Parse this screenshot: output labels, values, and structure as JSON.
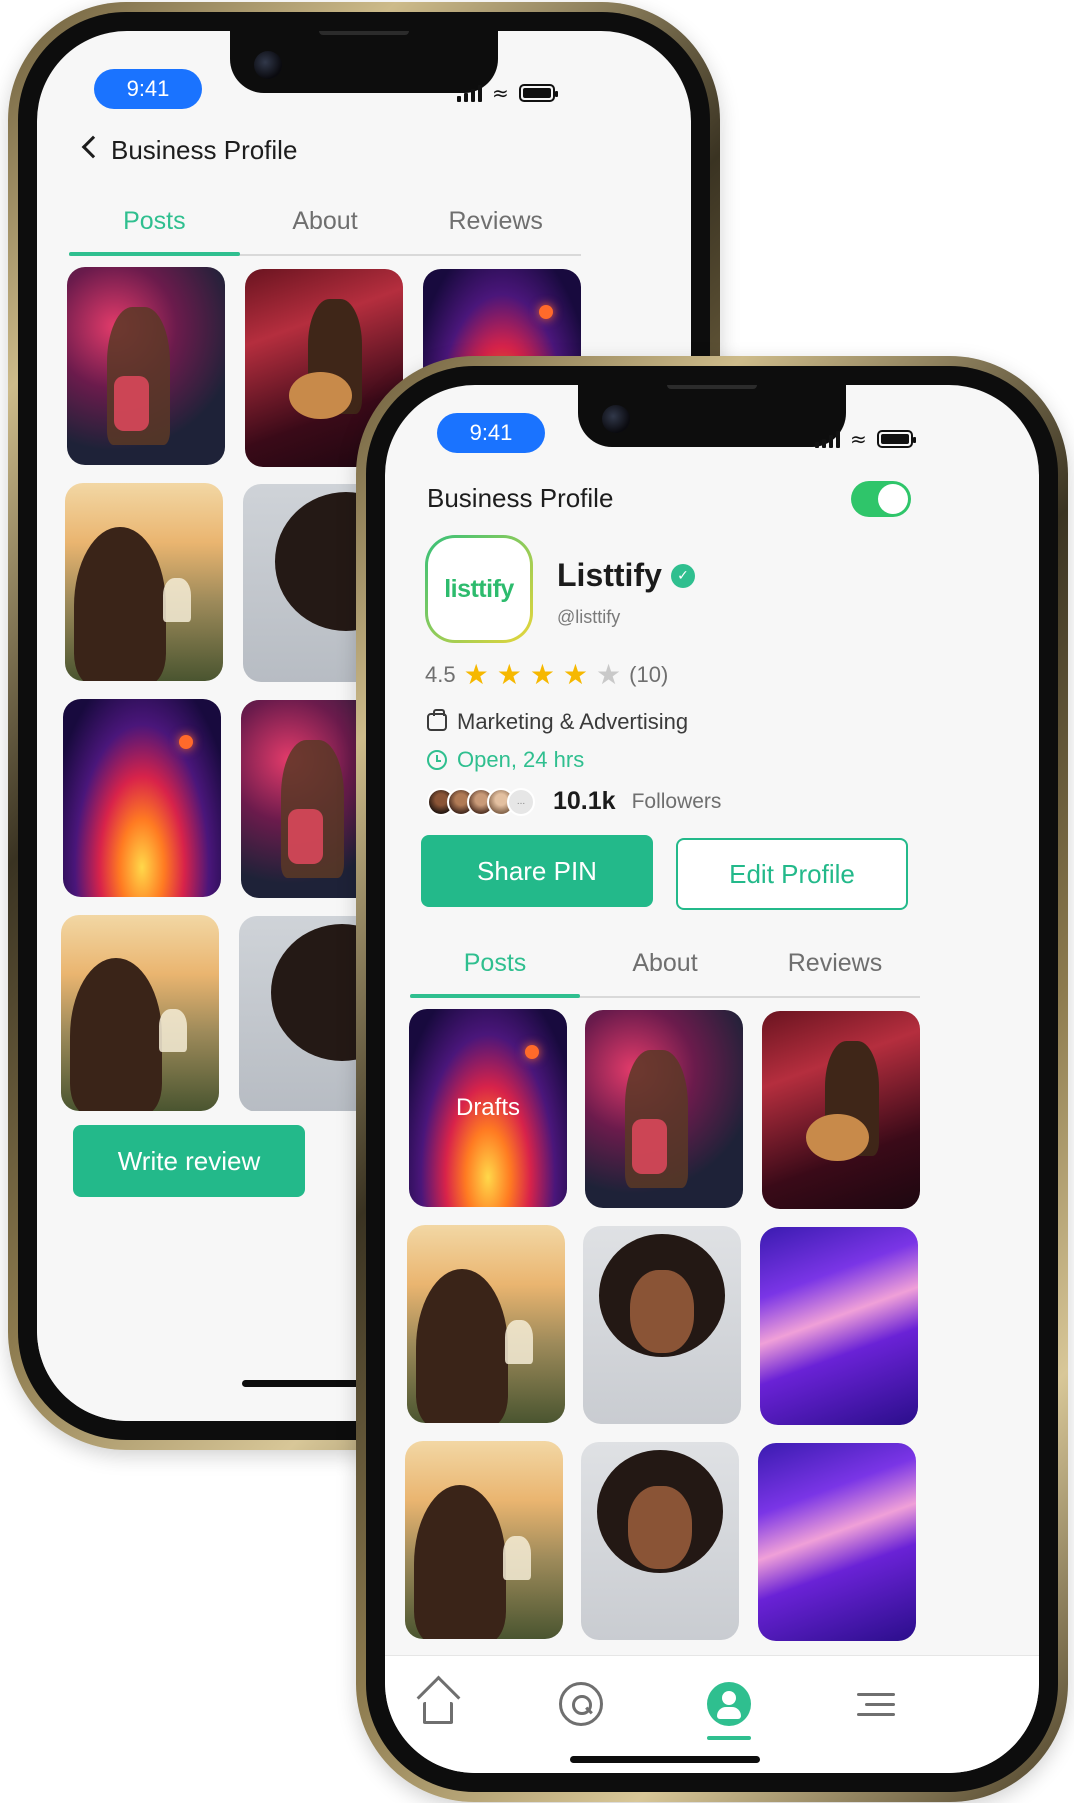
{
  "back_screen": {
    "status_time": "9:41",
    "header_title": "Business Profile",
    "tabs": [
      {
        "label": "Posts",
        "active": true
      },
      {
        "label": "About",
        "active": false
      },
      {
        "label": "Reviews",
        "active": false
      }
    ],
    "write_review_label": "Write review"
  },
  "front_screen": {
    "status_time": "9:41",
    "header_title": "Business Profile",
    "business_active": true,
    "logo_text": "listtify",
    "brand_name": "Listtify",
    "verified": true,
    "handle": "@listtify",
    "rating": {
      "score": "4.5",
      "stars_filled": 4,
      "stars_total": 5,
      "count": "(10)"
    },
    "category": "Marketing & Advertising",
    "hours": "Open, 24 hrs",
    "followers": {
      "count": "10.1k",
      "label": "Followers",
      "more": "..."
    },
    "share_pin_label": "Share PIN",
    "edit_profile_label": "Edit Profile",
    "tabs": [
      {
        "label": "Posts",
        "active": true
      },
      {
        "label": "About",
        "active": false
      },
      {
        "label": "Reviews",
        "active": false
      }
    ],
    "drafts_label": "Drafts",
    "nav": [
      {
        "icon": "home-icon",
        "active": false
      },
      {
        "icon": "search-icon",
        "active": false
      },
      {
        "icon": "profile-icon",
        "active": true
      },
      {
        "icon": "menu-icon",
        "active": false
      }
    ]
  },
  "colors": {
    "accent": "#23b98a",
    "tab_active": "#2fbf8f",
    "status_pill": "#1a73ff",
    "star": "#f6b800",
    "toggle": "#2fc56a"
  }
}
